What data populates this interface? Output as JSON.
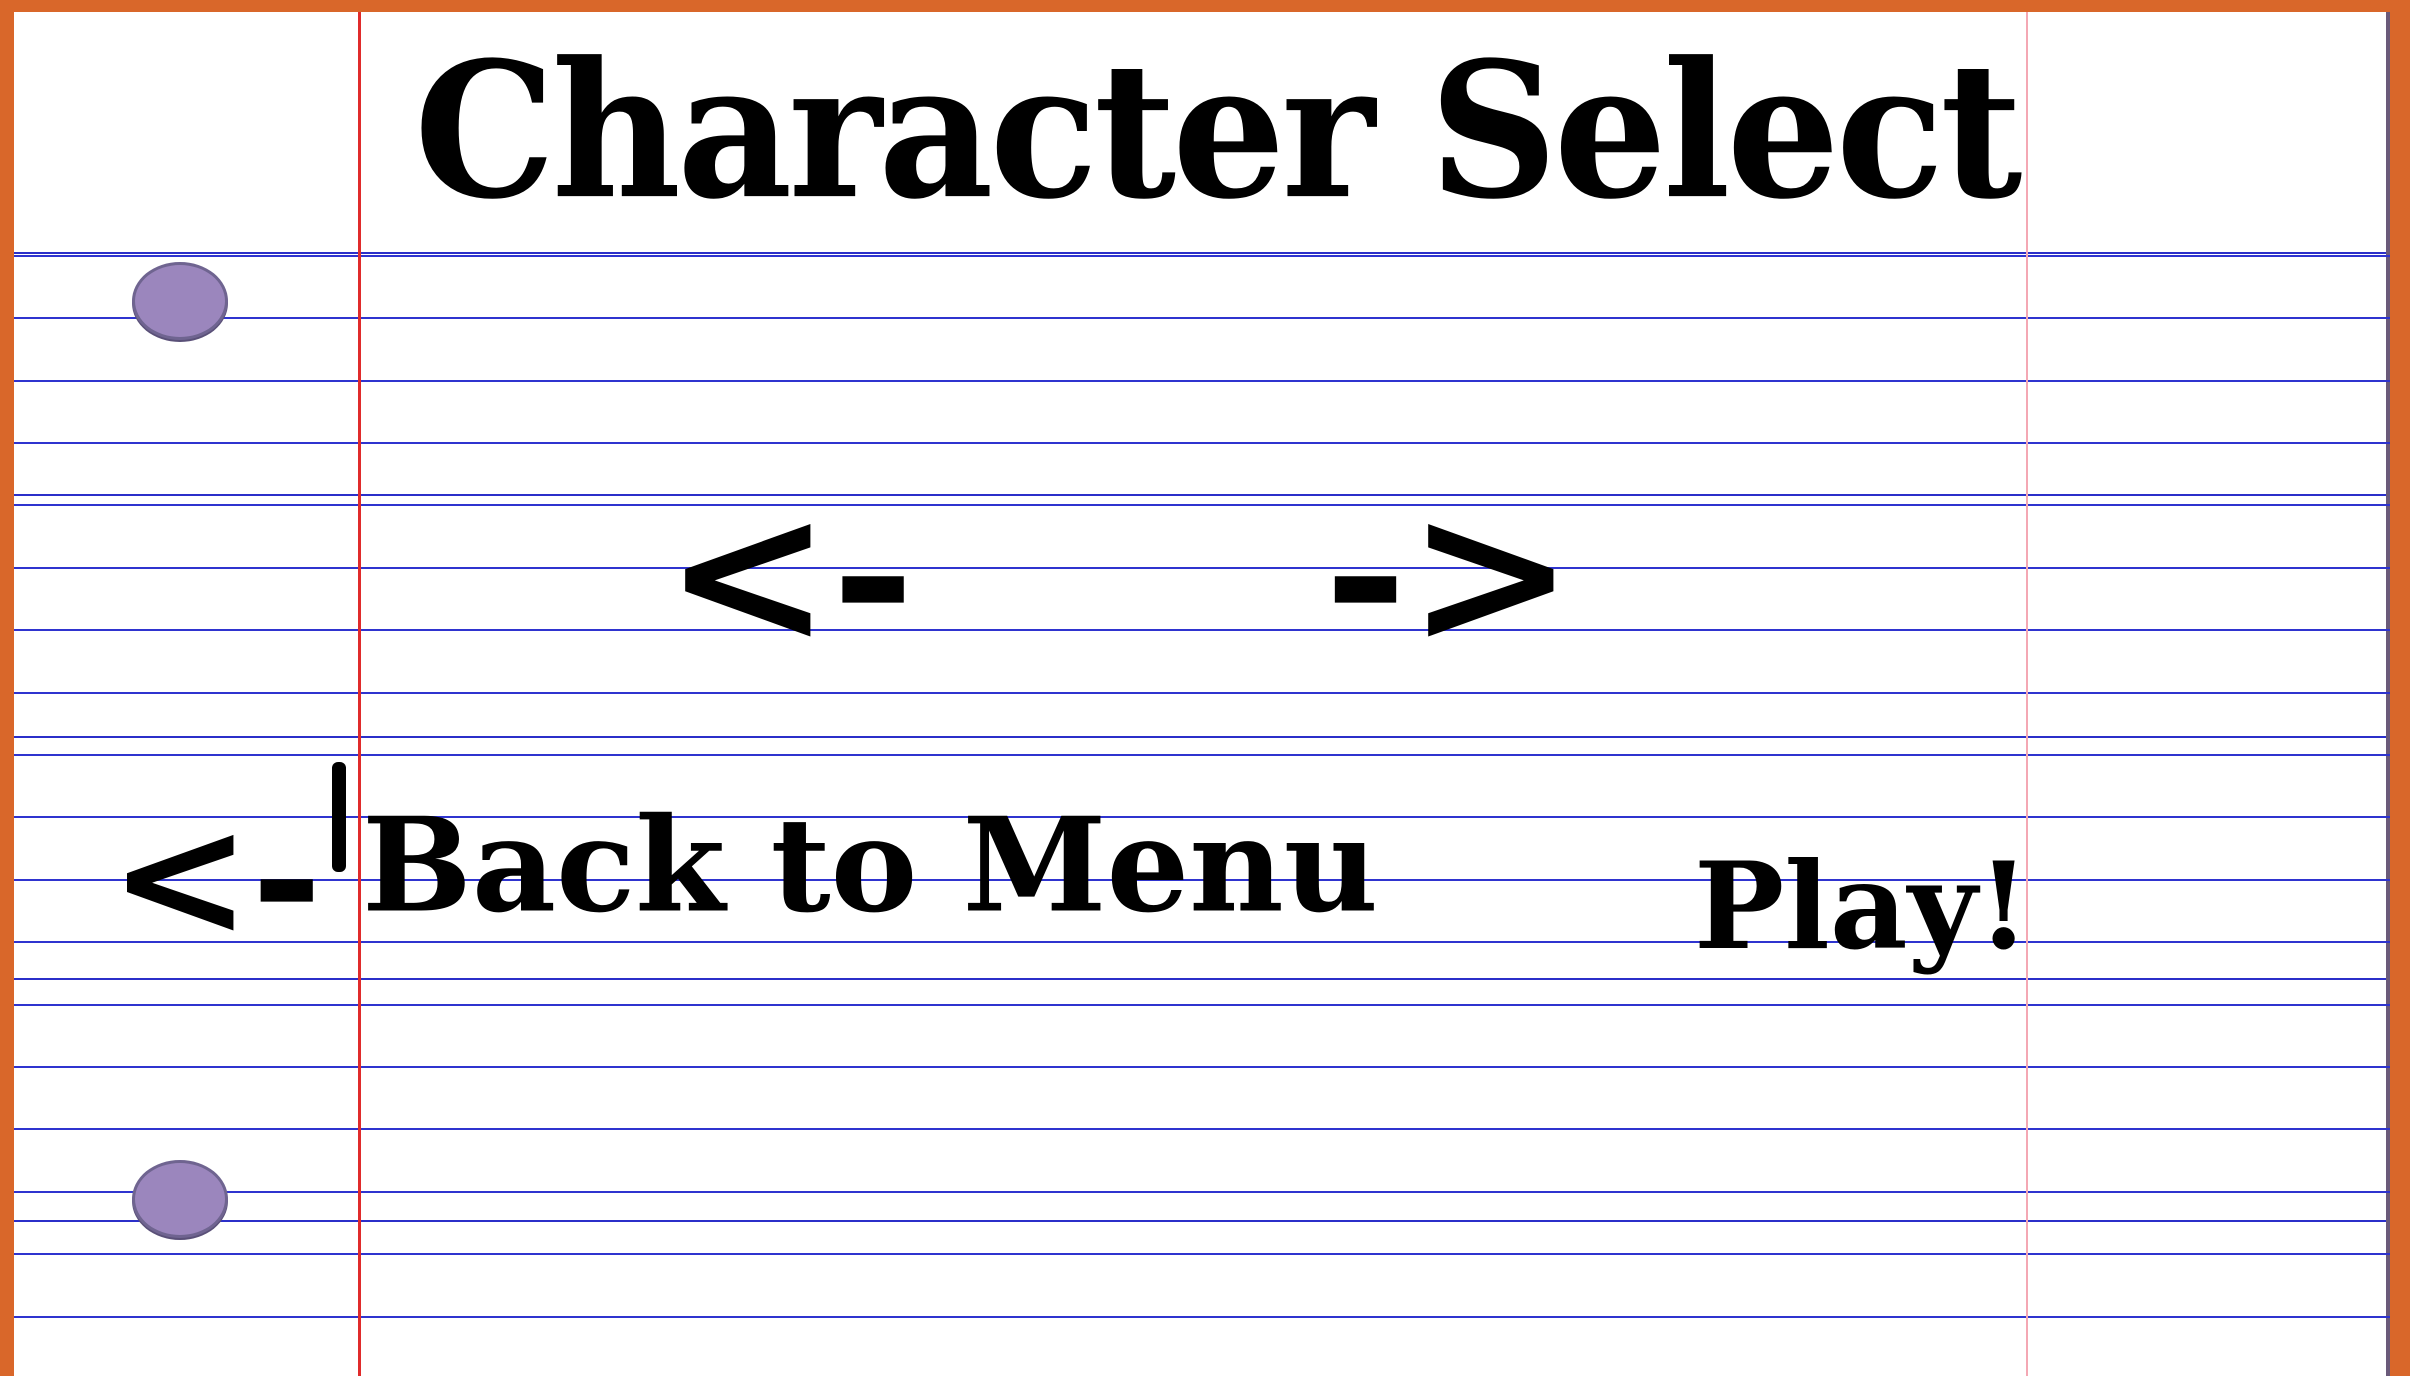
{
  "title": "Character Select",
  "prev_character": {
    "label": "<-"
  },
  "next_character": {
    "label": "->"
  },
  "back_button": {
    "arrow": "<-",
    "label": "Back to Menu"
  },
  "play_button": {
    "label": "Play!"
  },
  "colors": {
    "border": "#d9672a",
    "paper": "#ffffff",
    "rule_lines": "#2f34cf",
    "margin_line": "#e02b2b",
    "punch_hole": "#9b86bd"
  }
}
